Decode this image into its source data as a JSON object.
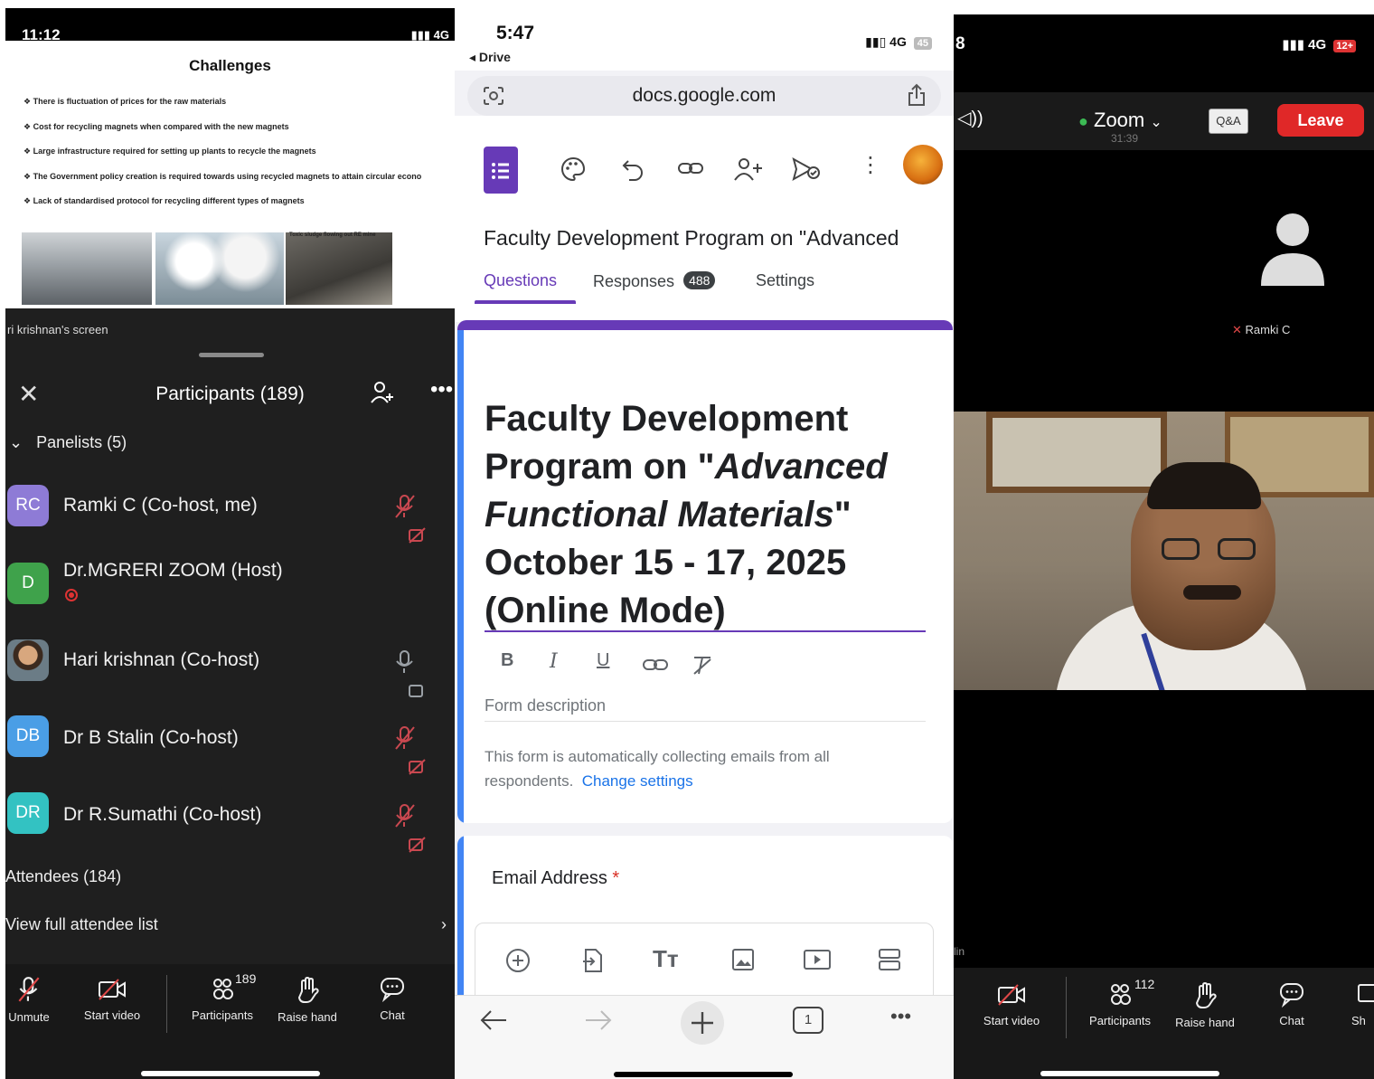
{
  "left": {
    "status": {
      "time": "11:12",
      "network": "4G"
    },
    "slide": {
      "title": "Challenges",
      "bullets": [
        "There is fluctuation of prices for the raw materials",
        "Cost for recycling magnets when compared with the new magnets",
        "Large infrastructure required for setting up plants to recycle the magnets",
        "The Government policy creation is required towards using recycled magnets to attain circular econo",
        "Lack of standardised protocol for recycling different types of magnets"
      ],
      "photo_caption": "Toxic sludge flowing out RE mine"
    },
    "screen_label": "ri krishnan's screen",
    "participants_title": "Participants (189)",
    "panelists_label": "Panelists (5)",
    "panelists": [
      {
        "initials": "RC",
        "name": "Ramki C (Co-host, me)",
        "color": "#8e7bd6"
      },
      {
        "initials": "D",
        "name": "Dr.MGRERI ZOOM (Host)",
        "color": "#3fa24b"
      },
      {
        "initials": "",
        "name": "Hari krishnan (Co-host)",
        "color": "#7a5a3c"
      },
      {
        "initials": "DB",
        "name": "Dr B Stalin (Co-host)",
        "color": "#4a9ee6"
      },
      {
        "initials": "DR",
        "name": "Dr R.Sumathi (Co-host)",
        "color": "#33c2c2"
      }
    ],
    "attendees_label": "Attendees (184)",
    "view_all_label": "View full attendee list",
    "toolbar": {
      "unmute": "Unmute",
      "start_video": "Start video",
      "participants": "Participants",
      "participants_count": "189",
      "raise_hand": "Raise hand",
      "chat": "Chat"
    }
  },
  "middle": {
    "status": {
      "time": "5:47",
      "back": "Drive",
      "network": "4G",
      "battery": "45"
    },
    "url": "docs.google.com",
    "form_title_short": "Faculty Development Program on \"Advanced",
    "tabs": {
      "questions": "Questions",
      "responses": "Responses",
      "responses_count": "488",
      "settings": "Settings"
    },
    "title_lines": {
      "l1": "Faculty Development",
      "l2a": "Program on \"",
      "l2b": "Advanced",
      "l3a": "Functional Materials",
      "l3b": "\"",
      "l4": "October 15 - 17, 2025",
      "l5": "(Online Mode)"
    },
    "description_placeholder": "Form description",
    "email_note": "This form is automatically collecting emails from all respondents.",
    "change_settings": "Change settings",
    "question_label": "Email Address",
    "required_mark": "*",
    "tab_count": "1"
  },
  "right": {
    "status": {
      "time": "8",
      "network": "4G",
      "battery": "12+"
    },
    "meeting_title": "Zoom",
    "timer": "31:39",
    "qa_label": "Q&A",
    "leave_label": "Leave",
    "tile_name": "Ramki C",
    "small_label": "lin",
    "toolbar": {
      "start_video": "Start video",
      "participants": "Participants",
      "participants_count": "112",
      "raise_hand": "Raise hand",
      "chat": "Chat",
      "share": "Sh"
    }
  }
}
